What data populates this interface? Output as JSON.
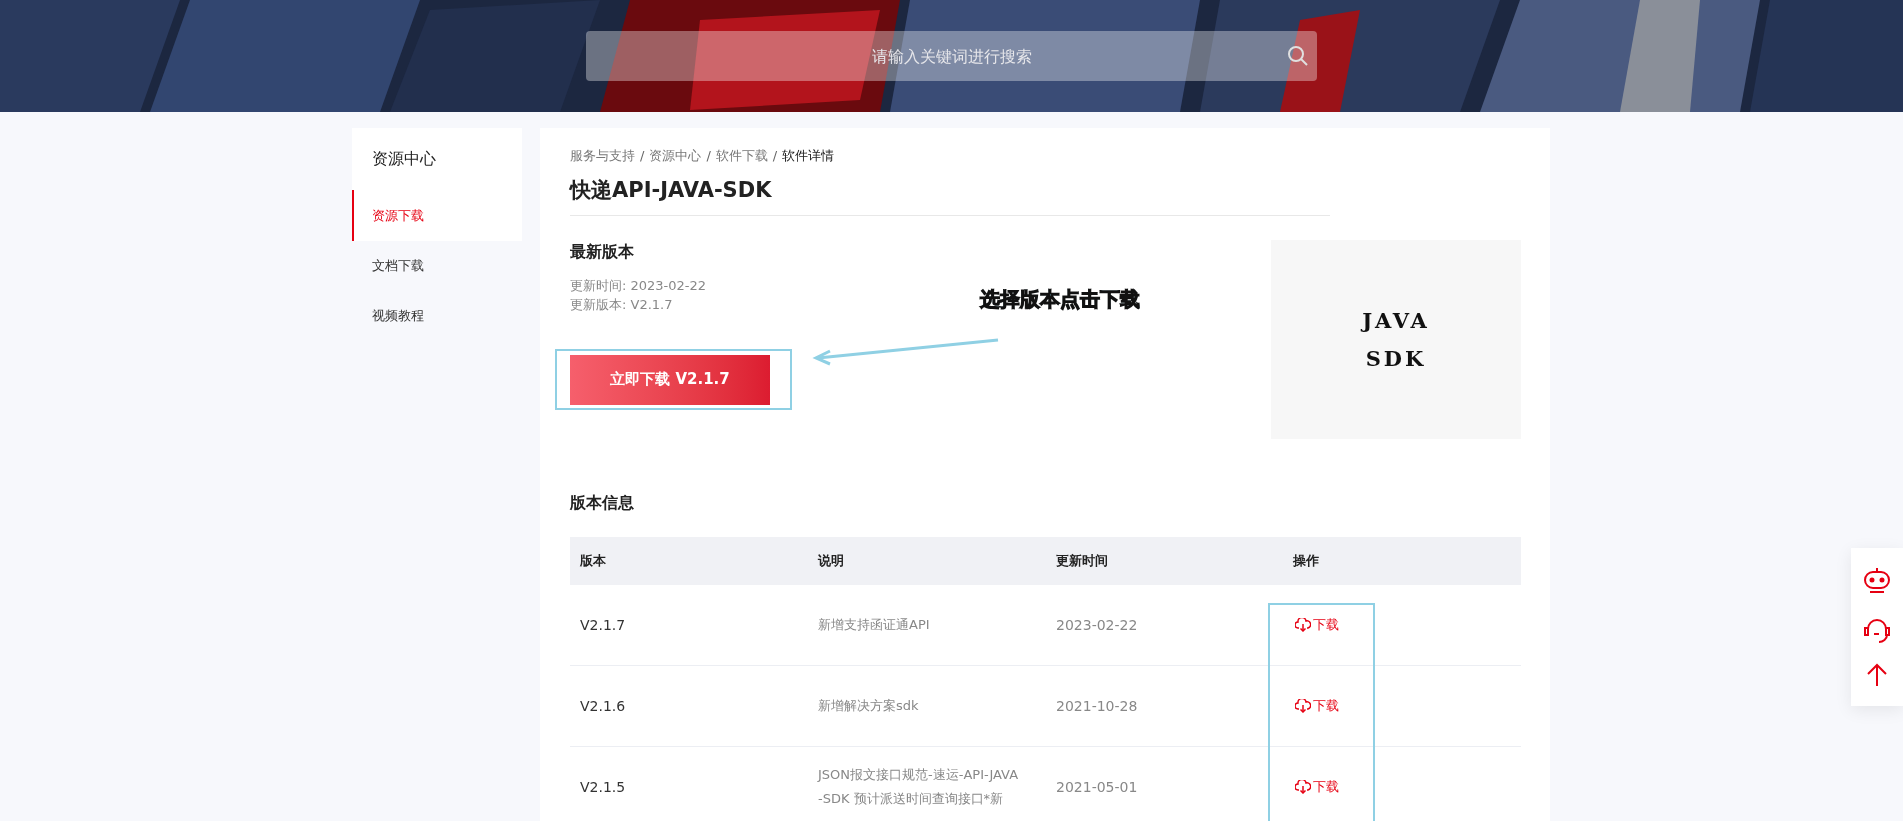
{
  "header": {
    "search": {
      "placeholder": "请输入关键词进行搜索"
    }
  },
  "sidebar": {
    "title": "资源中心",
    "items": [
      {
        "label": "资源下载",
        "selected": true
      },
      {
        "label": "文档下载",
        "selected": false
      },
      {
        "label": "视频教程",
        "selected": false
      }
    ]
  },
  "breadcrumb": [
    {
      "label": "服务与支持",
      "current": false
    },
    {
      "label": "资源中心",
      "current": false
    },
    {
      "label": "软件下载",
      "current": false
    },
    {
      "label": "软件详情",
      "current": true
    }
  ],
  "breadcrumb_separator": "/",
  "title": "快递API-JAVA-SDK",
  "latest": {
    "heading": "最新版本",
    "update_time": "更新时间: 2023-02-22",
    "update_version": "更新版本: V2.1.7",
    "download_button": "立即下载 V2.1.7"
  },
  "annotation": "选择版本点击下载",
  "logo_lines": [
    "JAVA",
    "SDK"
  ],
  "versions": {
    "heading": "版本信息",
    "columns": [
      "版本",
      "说明",
      "更新时间",
      "操作"
    ],
    "rows": [
      {
        "version": "V2.1.7",
        "description": "新增支持函证通API",
        "date": "2023-02-22",
        "action": "下载"
      },
      {
        "version": "V2.1.6",
        "description": "新增解决方案sdk",
        "date": "2021-10-28",
        "action": "下载"
      },
      {
        "version": "V2.1.5",
        "description": "JSON报文接口规范-速运-API-JAVA-SDK 预计派送时间查询接口*新",
        "date": "2021-05-01",
        "action": "下载"
      }
    ]
  },
  "float_toolbar": [
    {
      "kind": "robot"
    },
    {
      "kind": "headset"
    },
    {
      "kind": "top"
    }
  ]
}
